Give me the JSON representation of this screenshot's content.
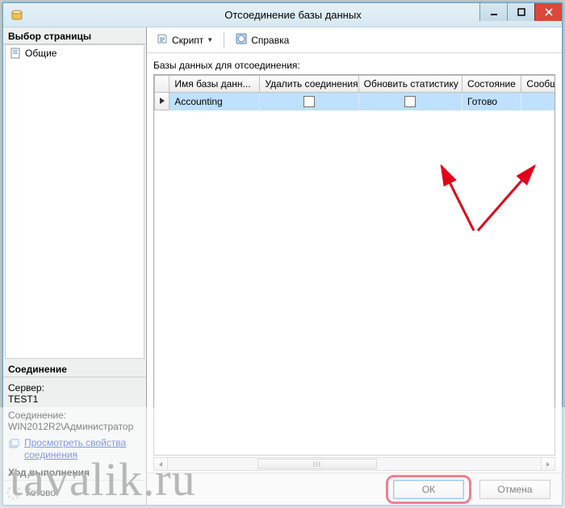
{
  "window": {
    "title": "Отсоединение базы данных"
  },
  "left": {
    "page_select_header": "Выбор страницы",
    "page_general": "Общие",
    "conn_header": "Соединение",
    "server_label": "Сервер:",
    "server_value": "TEST1",
    "conn_label": "Соединение:",
    "conn_value": "WIN2012R2\\Администратор",
    "view_conn_props": "Просмотреть свойства соединения",
    "exec_header": "Ход выполнения",
    "exec_status": "Готово"
  },
  "toolbar": {
    "script": "Скрипт",
    "help": "Справка"
  },
  "grid": {
    "label": "Базы данных для отсоединения:",
    "columns": {
      "name": "Имя базы данн...",
      "drop": "Удалить соединения",
      "update": "Обновить статистику",
      "state": "Состояние",
      "message": "Сообщение"
    },
    "rows": [
      {
        "name": "Accounting",
        "drop": false,
        "update": false,
        "state": "Готово",
        "message": ""
      }
    ]
  },
  "footer": {
    "ok": "ОК",
    "cancel": "Отмена"
  },
  "watermark": "tavalik.ru"
}
